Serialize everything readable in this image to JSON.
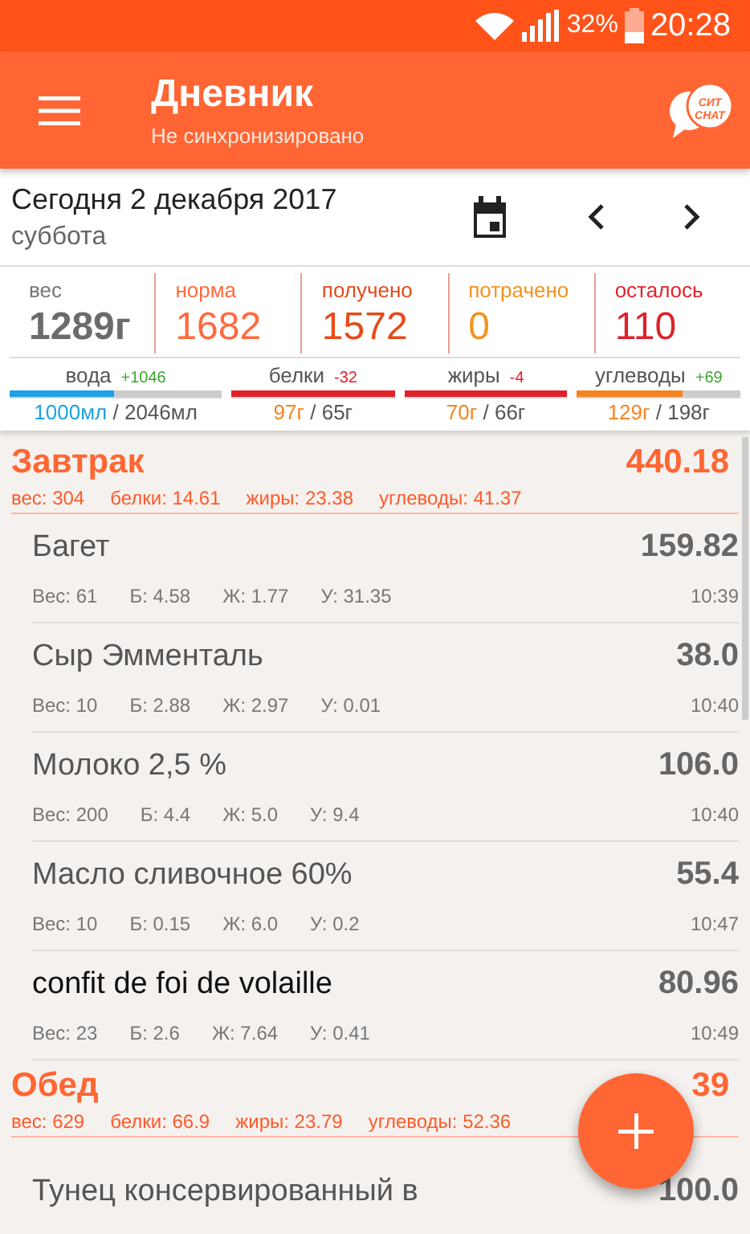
{
  "status_bar": {
    "battery": "32%",
    "time": "20:28"
  },
  "app_bar": {
    "title": "Дневник",
    "subtitle": "Не синхронизировано",
    "logo_text": [
      "СИТ",
      "CHAT"
    ]
  },
  "date_bar": {
    "date": "Сегодня 2 декабря 2017",
    "weekday": "суббота"
  },
  "summary": [
    {
      "label": "вес",
      "value": "1289г",
      "color": "#6b6b6b"
    },
    {
      "label": "норма",
      "value": "1682",
      "color": "#ff6a3d"
    },
    {
      "label": "получено",
      "value": "1572",
      "color": "#e64a19"
    },
    {
      "label": "потрачено",
      "value": "0",
      "color": "#f5921e"
    },
    {
      "label": "осталось",
      "value": "110",
      "color": "#e0212c"
    }
  ],
  "nutrients": [
    {
      "label": "вода",
      "delta": "+1046",
      "delta_good": true,
      "level": 0.49,
      "color": "#1da1e2",
      "eaten": "1000мл",
      "norm": "/ 2046мл"
    },
    {
      "label": "белки",
      "delta": "-32",
      "delta_good": false,
      "level": 1,
      "color": "#e0212c",
      "eaten": "97г",
      "norm": "/ 65г"
    },
    {
      "label": "жиры",
      "delta": "-4",
      "delta_good": false,
      "level": 1,
      "color": "#e0212c",
      "eaten": "70г",
      "norm": "/ 66г"
    },
    {
      "label": "углеводы",
      "delta": "+69",
      "delta_good": true,
      "level": 0.65,
      "color": "#f5841f",
      "eaten": "129г",
      "norm": "/ 198г"
    }
  ],
  "meals": [
    {
      "title": "Завтрак",
      "total": "440.18",
      "stats": [
        "вес: 304",
        "белки: 14.61",
        "жиры: 23.38",
        "углеводы: 41.37"
      ],
      "items": [
        {
          "name": "Багет",
          "calories": "159.82",
          "weight": "Вес: 61",
          "protein": "Б: 4.58",
          "fat": "Ж: 1.77",
          "carbs": "У: 31.35",
          "time": "10:39",
          "custom": false
        },
        {
          "name": "Сыр Эмменталь",
          "calories": "38.0",
          "weight": "Вес: 10",
          "protein": "Б: 2.88",
          "fat": "Ж: 2.97",
          "carbs": "У: 0.01",
          "time": "10:40",
          "custom": false
        },
        {
          "name": "Молоко 2,5 %",
          "calories": "106.0",
          "weight": "Вес: 200",
          "protein": "Б: 4.4",
          "fat": "Ж: 5.0",
          "carbs": "У: 9.4",
          "time": "10:40",
          "custom": false
        },
        {
          "name": "Масло сливочное 60%",
          "calories": "55.4",
          "weight": "Вес: 10",
          "protein": "Б: 0.15",
          "fat": "Ж: 6.0",
          "carbs": "У: 0.2",
          "time": "10:47",
          "custom": false
        },
        {
          "name": "confit de foi de volaille",
          "calories": "80.96",
          "weight": "Вес: 23",
          "protein": "Б: 2.6",
          "fat": "Ж: 7.64",
          "carbs": "У: 0.41",
          "time": "10:49",
          "custom": true
        }
      ]
    },
    {
      "title": "Обед",
      "total": "39",
      "stats": [
        "вес: 629",
        "белки: 66.9",
        "жиры: 23.79",
        "углеводы: 52.36"
      ],
      "items": [
        {
          "name": "Тунец консервированный в",
          "calories": "100.0",
          "custom": false
        }
      ]
    }
  ]
}
